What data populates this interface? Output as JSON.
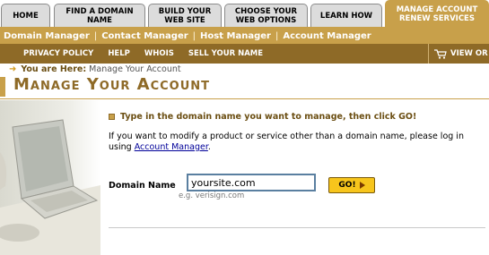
{
  "tabs": [
    {
      "label": "HOME"
    },
    {
      "label": "FIND A DOMAIN NAME"
    },
    {
      "label": "BUILD YOUR WEB SITE"
    },
    {
      "label": "CHOOSE YOUR WEB OPTIONS"
    },
    {
      "label": "LEARN HOW"
    },
    {
      "label": "MANAGE ACCOUNT RENEW SERVICES",
      "active": true
    }
  ],
  "subnav": {
    "items": [
      "Domain Manager",
      "Contact Manager",
      "Host Manager",
      "Account Manager"
    ],
    "separator": "|"
  },
  "utilnav": {
    "items": [
      "PRIVACY POLICY",
      "HELP",
      "WHOIS",
      "SELL YOUR NAME"
    ],
    "cart_label": "VIEW OR"
  },
  "breadcrumb": {
    "label": "You are Here:",
    "current": "Manage Your Account"
  },
  "page_title": "Manage Your Account",
  "main": {
    "instruction": "Type in the domain name you want to manage, then click GO!",
    "note_text": "If you want to modify a product or service other than a domain name, please log in using",
    "note_link": "Account Manager",
    "note_end": ".",
    "domain_label": "Domain Name",
    "domain_value": "yoursite.com",
    "domain_hint": "e.g. verisign.com",
    "go_label": "GO!"
  },
  "colors": {
    "gold": "#c8a04a",
    "brown": "#8e6a27",
    "go_yellow": "#f7c51c"
  }
}
